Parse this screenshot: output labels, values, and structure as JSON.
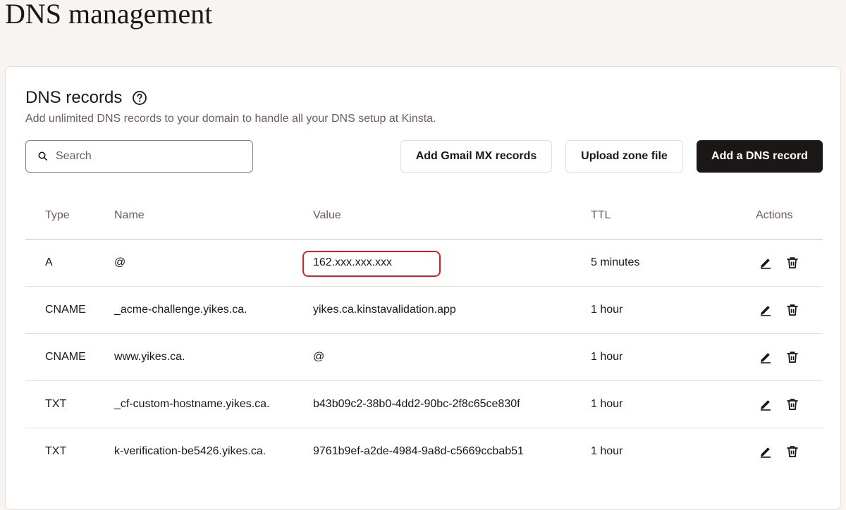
{
  "page": {
    "title": "DNS management"
  },
  "card": {
    "title": "DNS records",
    "description": "Add unlimited DNS records to your domain to handle all your DNS setup at Kinsta."
  },
  "search": {
    "placeholder": "Search",
    "value": ""
  },
  "buttons": {
    "gmail": "Add Gmail MX records",
    "upload": "Upload zone file",
    "add": "Add a DNS record"
  },
  "table": {
    "headers": {
      "type": "Type",
      "name": "Name",
      "value": "Value",
      "ttl": "TTL",
      "actions": "Actions"
    },
    "rows": [
      {
        "type": "A",
        "name": "@",
        "value": "162.xxx.xxx.xxx",
        "ttl": "5 minutes"
      },
      {
        "type": "CNAME",
        "name": "_acme-challenge.yikes.ca.",
        "value": "yikes.ca.kinstavalidation.app",
        "ttl": "1 hour"
      },
      {
        "type": "CNAME",
        "name": "www.yikes.ca.",
        "value": "@",
        "ttl": "1 hour"
      },
      {
        "type": "TXT",
        "name": "_cf-custom-hostname.yikes.ca.",
        "value": "b43b09c2-38b0-4dd2-90bc-2f8c65ce830f",
        "ttl": "1 hour"
      },
      {
        "type": "TXT",
        "name": "k-verification-be5426.yikes.ca.",
        "value": "9761b9ef-a2de-4984-9a8d-c5669ccbab51",
        "ttl": "1 hour"
      }
    ]
  },
  "icons": {
    "help": "help-circle-icon",
    "search": "search-icon",
    "edit": "pencil-icon",
    "delete": "trash-icon"
  },
  "colors": {
    "page_bg": "#f8f4f2",
    "primary_dark": "#1c1717",
    "muted_text": "#6e5c59",
    "highlight": "#d61f2a"
  }
}
